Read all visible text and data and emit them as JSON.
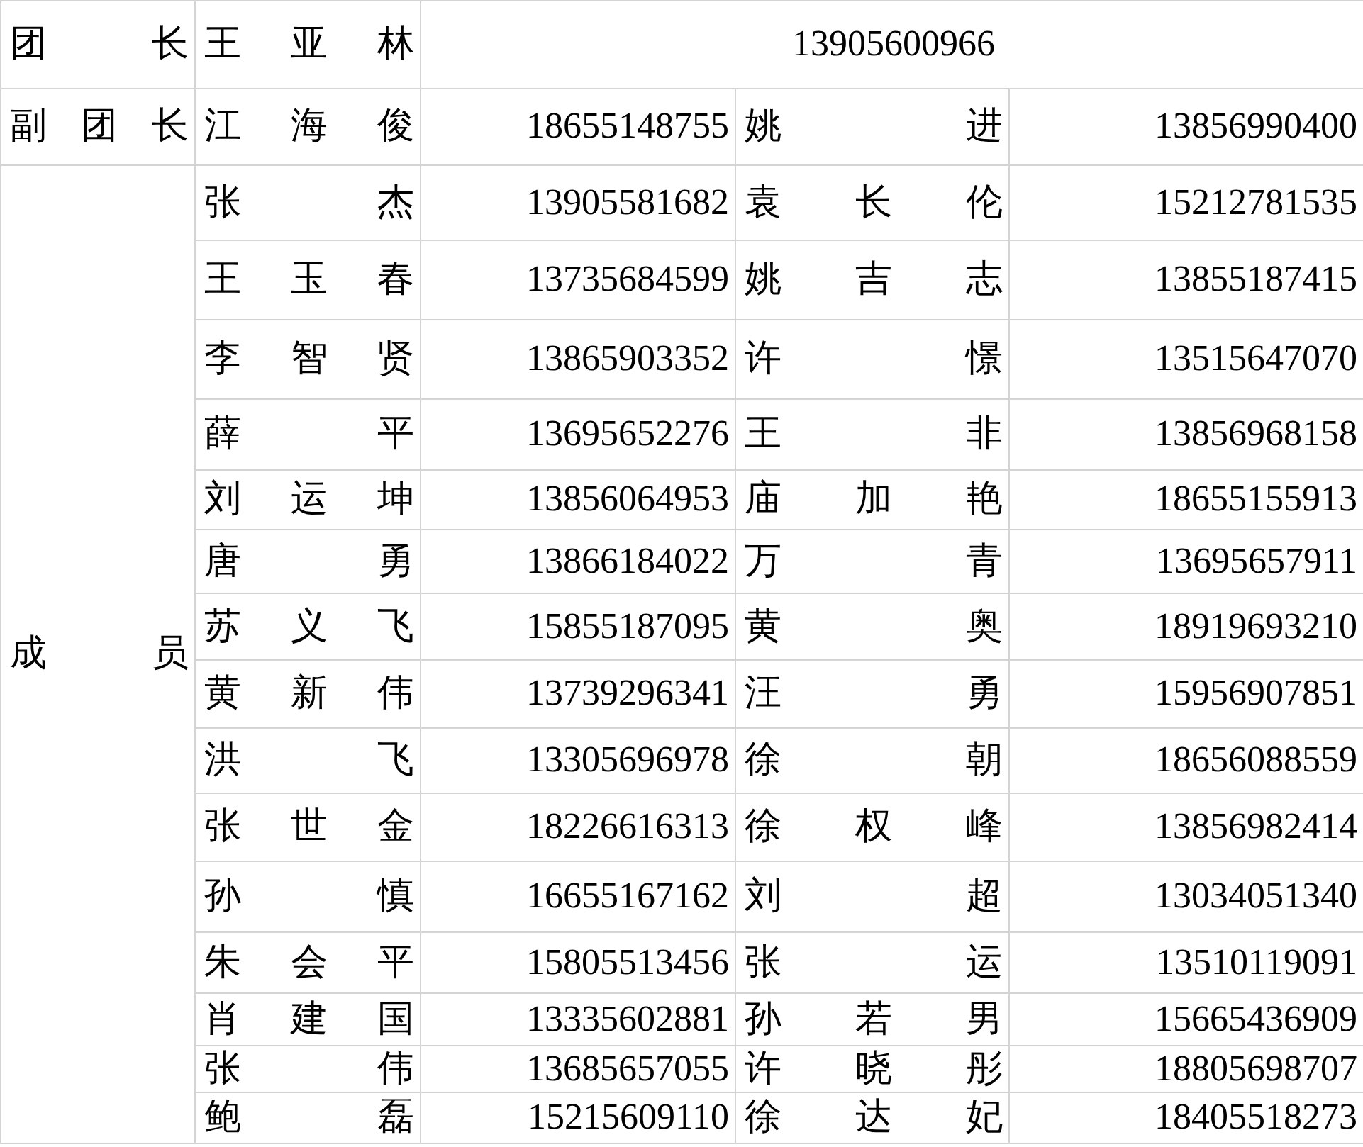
{
  "leader": {
    "role": "团 长",
    "name": "王 亚 林",
    "phone": "13905600966"
  },
  "deputies": {
    "role": "副 团 长",
    "left": {
      "name": "江 海 俊",
      "phone": "18655148755"
    },
    "right": {
      "name": "姚 进",
      "phone": "13856990400"
    }
  },
  "members": {
    "role": "成 员",
    "rows": [
      {
        "left": {
          "name": "张 杰",
          "phone": "13905581682"
        },
        "right": {
          "name": "袁 长 伦",
          "phone": "15212781535"
        }
      },
      {
        "left": {
          "name": "王 玉 春",
          "phone": "13735684599"
        },
        "right": {
          "name": "姚 吉 志",
          "phone": "13855187415"
        }
      },
      {
        "left": {
          "name": "李 智 贤",
          "phone": "13865903352"
        },
        "right": {
          "name": "许 憬",
          "phone": "13515647070"
        }
      },
      {
        "left": {
          "name": "薛 平",
          "phone": "13695652276"
        },
        "right": {
          "name": "王 非",
          "phone": "13856968158"
        }
      },
      {
        "left": {
          "name": "刘 运 坤",
          "phone": "13856064953"
        },
        "right": {
          "name": "庙 加 艳",
          "phone": "18655155913"
        }
      },
      {
        "left": {
          "name": "唐 勇",
          "phone": "13866184022"
        },
        "right": {
          "name": "万 青",
          "phone": "13695657911"
        }
      },
      {
        "left": {
          "name": "苏 义 飞",
          "phone": "15855187095"
        },
        "right": {
          "name": "黄 奥",
          "phone": "18919693210"
        }
      },
      {
        "left": {
          "name": "黄 新 伟",
          "phone": "13739296341"
        },
        "right": {
          "name": "汪 勇",
          "phone": "15956907851"
        }
      },
      {
        "left": {
          "name": "洪 飞",
          "phone": "13305696978"
        },
        "right": {
          "name": "徐 朝",
          "phone": "18656088559"
        }
      },
      {
        "left": {
          "name": "张 世 金",
          "phone": "18226616313"
        },
        "right": {
          "name": "徐 权 峰",
          "phone": "13856982414"
        }
      },
      {
        "left": {
          "name": "孙 慎",
          "phone": "16655167162"
        },
        "right": {
          "name": "刘 超",
          "phone": "13034051340"
        }
      },
      {
        "left": {
          "name": "朱 会 平",
          "phone": "15805513456"
        },
        "right": {
          "name": "张 运",
          "phone": "13510119091"
        }
      },
      {
        "left": {
          "name": "肖 建 国",
          "phone": "13335602881"
        },
        "right": {
          "name": "孙 若 男",
          "phone": "15665436909"
        }
      },
      {
        "left": {
          "name": "张 伟",
          "phone": "13685657055"
        },
        "right": {
          "name": "许 晓 彤",
          "phone": "18805698707"
        }
      },
      {
        "left": {
          "name": "鲍 磊",
          "phone": "15215609110"
        },
        "right": {
          "name": "徐 达 妃",
          "phone": "18405518273"
        }
      }
    ]
  }
}
